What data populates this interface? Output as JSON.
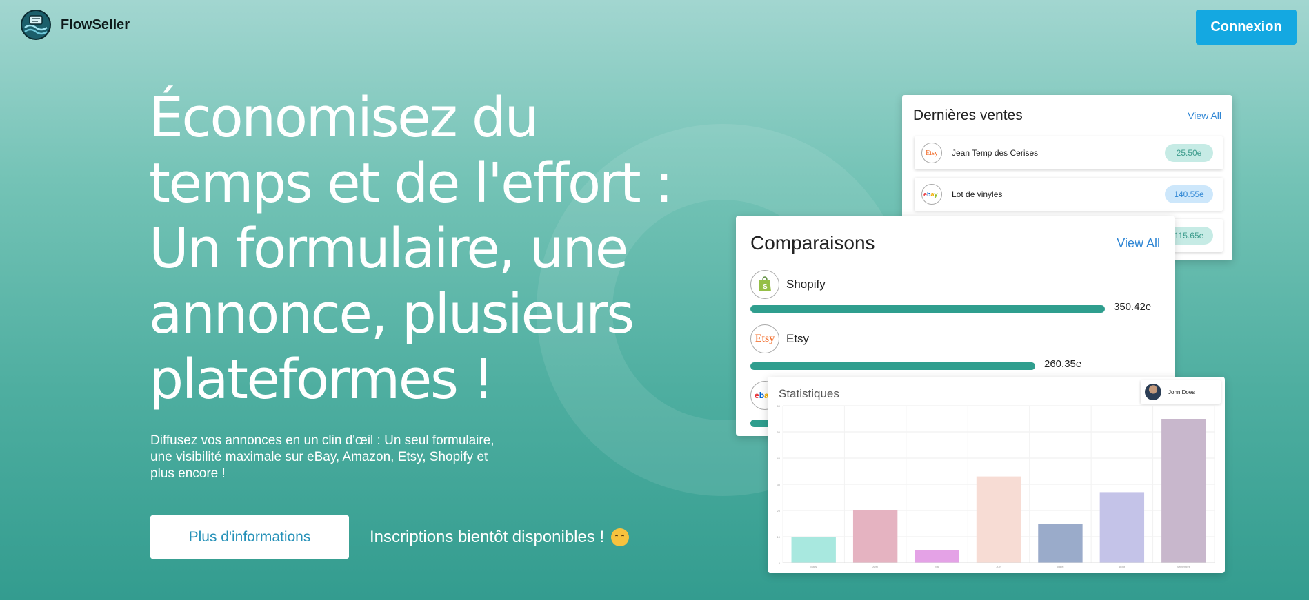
{
  "brand": {
    "name": "FlowSeller",
    "logo_icon": "flowseller-logo-icon"
  },
  "header": {
    "login_label": "Connexion"
  },
  "hero": {
    "title_lines": [
      "Économisez du",
      "temps et de l'effort :",
      "Un formulaire, une",
      "annonce, plusieurs",
      "plateformes !"
    ],
    "subtitle": "Diffusez vos annonces en un clin d'œil : Un seul formulaire, une visibilité maximale sur eBay, Amazon, Etsy, Shopify et plus encore !",
    "cta_label": "Plus d'informations",
    "coming_soon": "Inscriptions bientôt disponibles !",
    "coming_soon_icon": "partying-face-emoji-icon"
  },
  "sales_card": {
    "title": "Dernières ventes",
    "view_all": "View All",
    "rows": [
      {
        "platform": "Etsy",
        "name": "Jean Temp des Cerises",
        "price": "25.50e",
        "price_style": "teal"
      },
      {
        "platform": "ebay",
        "name": "Lot de vinyles",
        "price": "140.55e",
        "price_style": "blue"
      },
      {
        "platform": "",
        "name": "",
        "price": "115.65e",
        "price_style": "teal"
      }
    ]
  },
  "comparisons_card": {
    "title": "Comparaisons",
    "view_all": "View All",
    "platforms": [
      {
        "name": "Shopify",
        "value": "350.42e",
        "fraction": 0.81,
        "icon": "shopify-icon"
      },
      {
        "name": "Etsy",
        "value": "260.35e",
        "fraction": 0.65,
        "icon": "etsy-icon"
      },
      {
        "name": "",
        "value": "",
        "fraction": 0.2,
        "icon": "ebay-icon"
      }
    ]
  },
  "stats_card": {
    "title": "Statistiques",
    "user_name": "John Does"
  },
  "chart_data": {
    "type": "bar",
    "title": "Statistiques",
    "categories": [
      "Mars",
      "Avril",
      "Mai",
      "Juin",
      "Juillet",
      "Aout",
      "Septembre"
    ],
    "values": [
      10,
      20,
      5,
      33,
      15,
      27,
      55
    ],
    "colors": [
      "#a8e8df",
      "#e5b3c1",
      "#e4a2e6",
      "#f7dcd4",
      "#9aabca",
      "#c4c3e8",
      "#c8b7cc"
    ],
    "ylim": [
      0,
      60
    ],
    "yticks": [
      0,
      10,
      20,
      30,
      40,
      50,
      60
    ],
    "grid": true
  },
  "colors": {
    "login_button": "#14a8e1",
    "bar_fill": "#2f9e8e",
    "link": "#2f86d4"
  }
}
